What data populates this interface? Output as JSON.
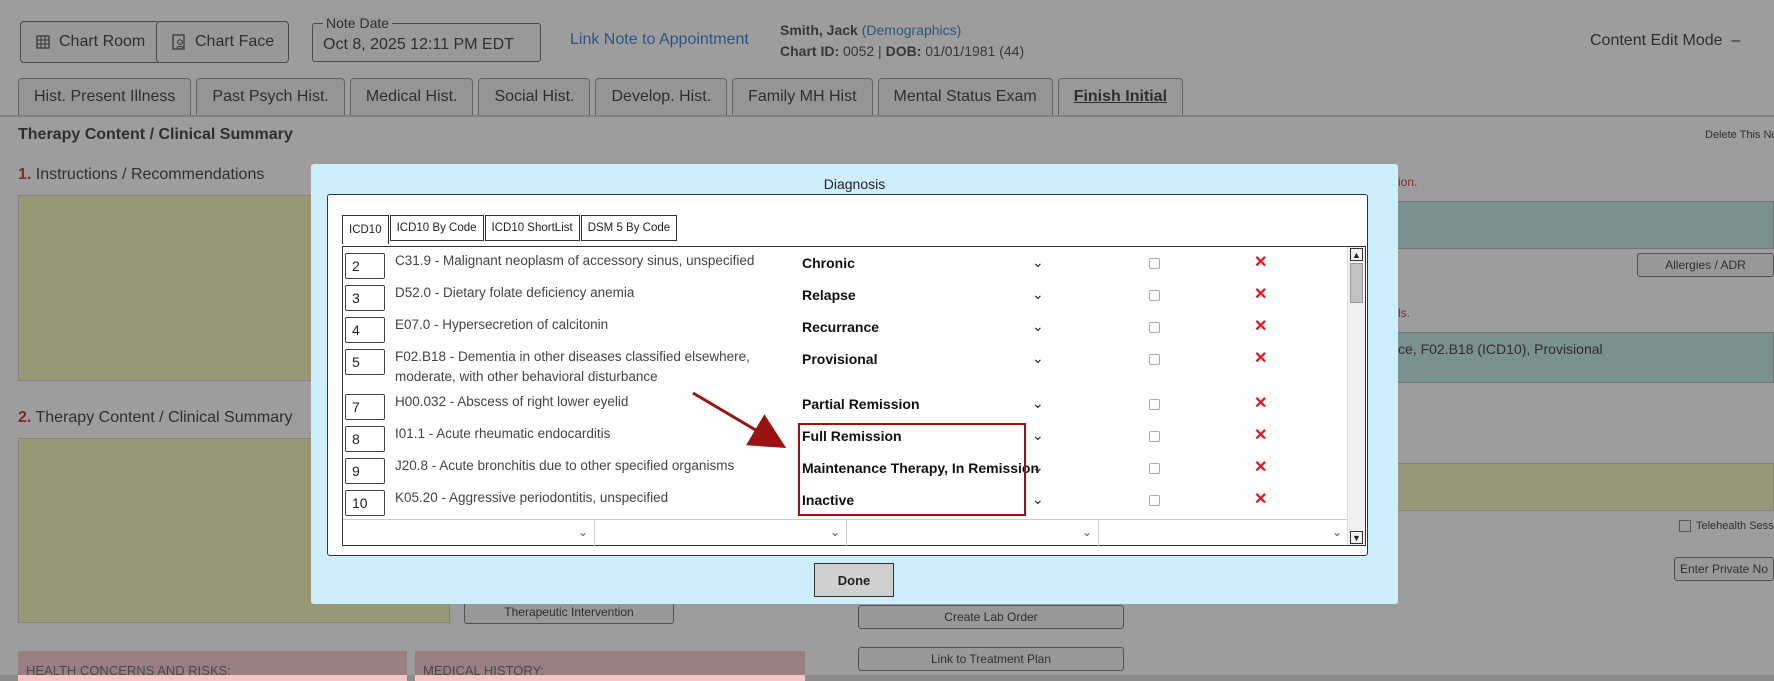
{
  "header": {
    "chart_room_label": "Chart Room",
    "chart_face_label": "Chart Face",
    "note_date_label": "Note Date",
    "note_date_value": "Oct 8, 2025 12:11 PM EDT",
    "link_appointment": "Link Note to Appointment",
    "patient_name": "Smith, Jack",
    "demographics_link": "(Demographics)",
    "chart_id_label": "Chart ID:",
    "chart_id": "0052",
    "dob_label": "DOB:",
    "dob": "01/01/1981 (44)",
    "mode_label": "Content Edit Mode",
    "mode_toggle": "–"
  },
  "tabs": [
    {
      "label": "Hist. Present Illness"
    },
    {
      "label": "Past Psych Hist."
    },
    {
      "label": "Medical Hist."
    },
    {
      "label": "Social Hist."
    },
    {
      "label": "Develop. Hist."
    },
    {
      "label": "Family MH Hist"
    },
    {
      "label": "Mental Status Exam"
    },
    {
      "label": "Finish Initial"
    }
  ],
  "page": {
    "section_title": "Therapy Content / Clinical Summary",
    "delete_note": "Delete This Not",
    "sub1_num": "1.",
    "sub1_label": "Instructions / Recommendations",
    "sub2_num": "2.",
    "sub2_label": "Therapy Content / Clinical Summary",
    "therapeutic_intervention": "Therapeutic Intervention",
    "create_lab_order": "Create Lab Order",
    "link_treatment_plan": "Link to Treatment Plan",
    "health_concerns": "HEALTH CONCERNS AND RISKS:",
    "medical_history": "MEDICAL HISTORY:",
    "right_red_1": "ion.",
    "right_red_2": "ls.",
    "allergies_button": "Allergies / ADR",
    "dx_summary": "ce, F02.B18 (ICD10), Provisional",
    "telehealth": "Telehealth Sess",
    "enter_private_note": "Enter Private No"
  },
  "modal": {
    "title": "Diagnosis",
    "tabs": [
      "ICD10",
      "ICD10 By Code",
      "ICD10 ShortList",
      "DSM 5 By Code"
    ],
    "rows": [
      {
        "num": "2",
        "desc": "C31.9 - Malignant neoplasm of accessory sinus, unspecified",
        "status": "Chronic"
      },
      {
        "num": "3",
        "desc": "D52.0 - Dietary folate deficiency anemia",
        "status": "Relapse"
      },
      {
        "num": "4",
        "desc": "E07.0 - Hypersecretion of calcitonin",
        "status": "Recurrance"
      },
      {
        "num": "5",
        "desc": "F02.B18 - Dementia in other diseases classified elsewhere, moderate, with other behavioral disturbance",
        "status": "Provisional"
      },
      {
        "num": "7",
        "desc": "H00.032 - Abscess of right lower eyelid",
        "status": "Partial Remission"
      },
      {
        "num": "8",
        "desc": "I01.1 - Acute rheumatic endocarditis",
        "status": "Full Remission"
      },
      {
        "num": "9",
        "desc": "J20.8 - Acute bronchitis due to other specified organisms",
        "status": "Maintenance Therapy, In Remission"
      },
      {
        "num": "10",
        "desc": "K05.20 - Aggressive periodontitis, unspecified",
        "status": "Inactive"
      }
    ],
    "done_label": "Done"
  },
  "colors": {
    "accent_link": "#1a6fc4",
    "delete_red": "#e0161c",
    "highlight_border": "#9b1212",
    "modal_bg": "#cdeefb"
  }
}
